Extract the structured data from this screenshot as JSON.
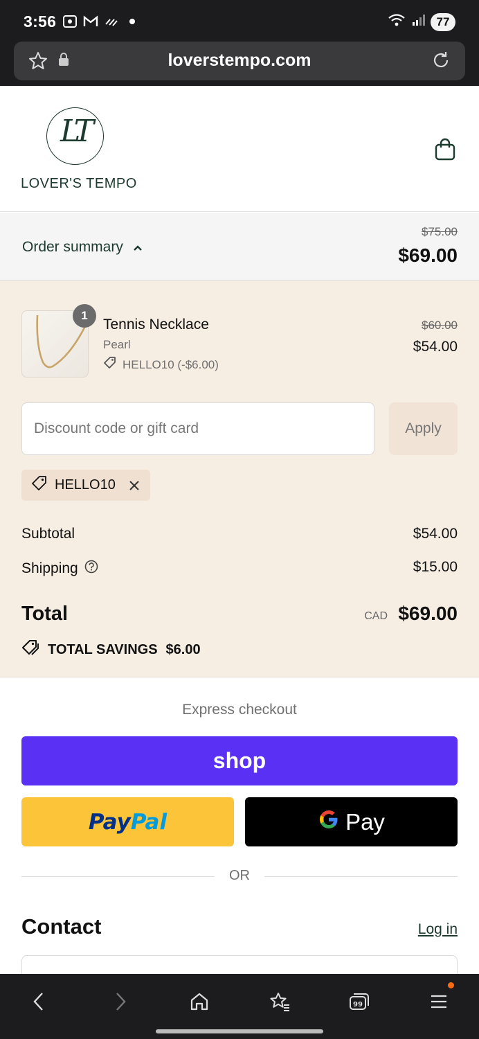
{
  "status_bar": {
    "time": "3:56",
    "battery": "77"
  },
  "browser": {
    "url": "loverstempo.com"
  },
  "store": {
    "logo_monogram": "LT",
    "logo_text": "LOVER'S TEMPO"
  },
  "summary_bar": {
    "label": "Order summary",
    "original_total": "$75.00",
    "total": "$69.00"
  },
  "line_item": {
    "quantity": "1",
    "name": "Tennis Necklace",
    "variant": "Pearl",
    "discount": "HELLO10 (-$6.00)",
    "original_price": "$60.00",
    "price": "$54.00"
  },
  "discount": {
    "placeholder": "Discount code or gift card",
    "apply_label": "Apply",
    "applied_code": "HELLO10"
  },
  "totals": {
    "subtotal_label": "Subtotal",
    "subtotal_value": "$54.00",
    "shipping_label": "Shipping",
    "shipping_value": "$15.00",
    "total_label": "Total",
    "currency": "CAD",
    "total_value": "$69.00",
    "savings_label": "TOTAL SAVINGS",
    "savings_value": "$6.00"
  },
  "express": {
    "title": "Express checkout",
    "shop_label": "shop",
    "paypal_part1": "Pay",
    "paypal_part2": "Pal",
    "gpay_label": "Pay",
    "or_label": "OR"
  },
  "contact": {
    "title": "Contact",
    "login_label": "Log in"
  },
  "colors": {
    "brand_green": "#1d3a2f",
    "panel_beige": "#f6ede3",
    "shop_purple": "#5a31f4",
    "paypal_yellow": "#fcc439"
  }
}
